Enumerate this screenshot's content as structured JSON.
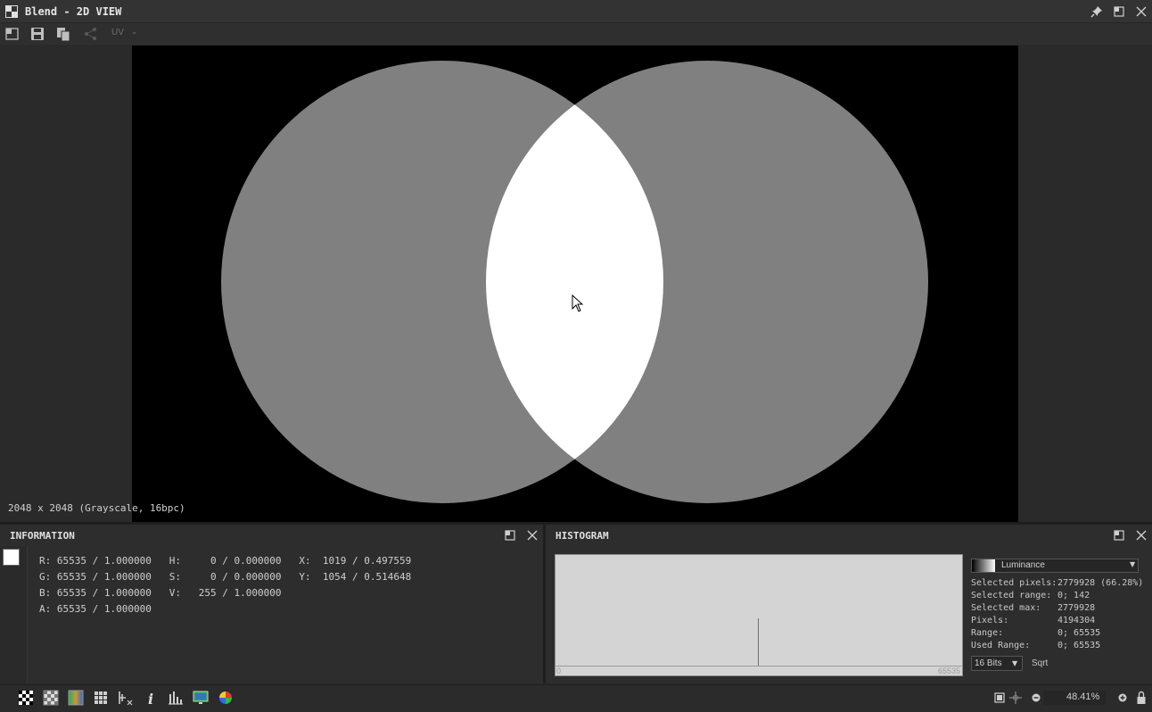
{
  "window": {
    "title": "Blend - 2D VIEW"
  },
  "toolbar": {
    "uv_label": "UV"
  },
  "viewport": {
    "image_info": "2048 x 2048 (Grayscale, 16bpc)"
  },
  "info_panel": {
    "title": "INFORMATION",
    "rows": [
      "R: 65535 / 1.000000   H:     0 / 0.000000   X:  1019 / 0.497559",
      "G: 65535 / 1.000000   S:     0 / 0.000000   Y:  1054 / 0.514648",
      "B: 65535 / 1.000000   V:   255 / 1.000000",
      "A: 65535 / 1.000000"
    ]
  },
  "histogram": {
    "title": "HISTOGRAM",
    "axis_min": "0",
    "axis_max": "65535",
    "channel": "Luminance",
    "stats": [
      {
        "k": "Selected pixels:",
        "v": "2779928 (66.28%)"
      },
      {
        "k": "Selected range:",
        "v": "0; 142"
      },
      {
        "k": "Selected max:",
        "v": "2779928"
      },
      {
        "k": "Pixels:",
        "v": "4194304"
      },
      {
        "k": "Range:",
        "v": "0; 65535"
      },
      {
        "k": "Used Range:",
        "v": "0; 65535"
      }
    ],
    "bits": "16 Bits",
    "sqrt": "Sqrt"
  },
  "statusbar": {
    "zoom": "48.41%"
  },
  "colors": {
    "circle_gray": "#808080",
    "overlap_white": "#ffffff",
    "background": "#000000"
  }
}
